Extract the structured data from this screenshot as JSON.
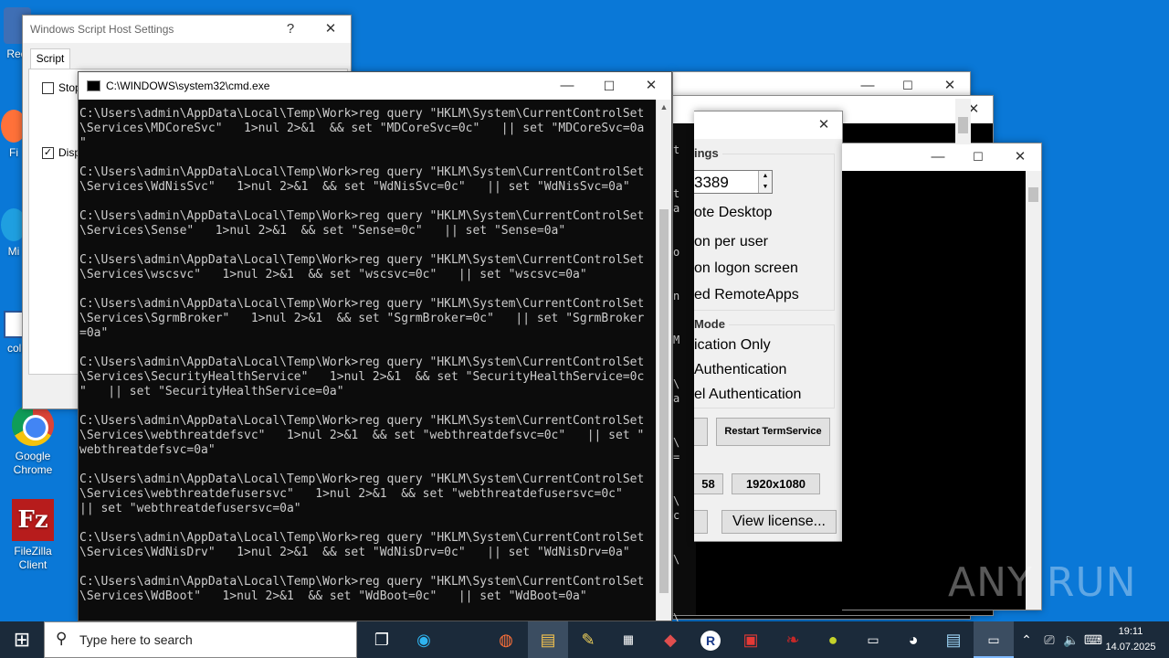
{
  "desktop": {
    "icons": [
      {
        "label": "Rec",
        "icon": "recycle-bin-icon"
      },
      {
        "label": "Fi",
        "icon": "firefox-icon"
      },
      {
        "label": "Mi",
        "icon": "edge-icon"
      },
      {
        "label": "coll",
        "icon": "word-icon"
      },
      {
        "label": "Google Chrome",
        "icon": "chrome-icon"
      },
      {
        "label": "FileZilla Client",
        "icon": "filezilla-icon"
      }
    ]
  },
  "wsh_window": {
    "title": "Windows Script Host Settings",
    "help_glyph": "?",
    "close_glyph": "✕",
    "tab": "Script",
    "checkbox1_label": "Stop",
    "checkbox1_checked": false,
    "checkbox2_label": "Disp",
    "checkbox2_checked": true
  },
  "cmd_window": {
    "title": "C:\\WINDOWS\\system32\\cmd.exe",
    "minimize_glyph": "—",
    "maximize_glyph": "☐",
    "close_glyph": "✕",
    "lines": [
      "C:\\Users\\admin\\AppData\\Local\\Temp\\Work>reg query \"HKLM\\System\\CurrentControlSet",
      "\\Services\\MDCoreSvc\"   1>nul 2>&1  && set \"MDCoreSvc=0c\"   || set \"MDCoreSvc=0a",
      "\"",
      "",
      "C:\\Users\\admin\\AppData\\Local\\Temp\\Work>reg query \"HKLM\\System\\CurrentControlSet",
      "\\Services\\WdNisSvc\"   1>nul 2>&1  && set \"WdNisSvc=0c\"   || set \"WdNisSvc=0a\"",
      "",
      "C:\\Users\\admin\\AppData\\Local\\Temp\\Work>reg query \"HKLM\\System\\CurrentControlSet",
      "\\Services\\Sense\"   1>nul 2>&1  && set \"Sense=0c\"   || set \"Sense=0a\"",
      "",
      "C:\\Users\\admin\\AppData\\Local\\Temp\\Work>reg query \"HKLM\\System\\CurrentControlSet",
      "\\Services\\wscsvc\"   1>nul 2>&1  && set \"wscsvc=0c\"   || set \"wscsvc=0a\"",
      "",
      "C:\\Users\\admin\\AppData\\Local\\Temp\\Work>reg query \"HKLM\\System\\CurrentControlSet",
      "\\Services\\SgrmBroker\"   1>nul 2>&1  && set \"SgrmBroker=0c\"   || set \"SgrmBroker",
      "=0a\"",
      "",
      "C:\\Users\\admin\\AppData\\Local\\Temp\\Work>reg query \"HKLM\\System\\CurrentControlSet",
      "\\Services\\SecurityHealthService\"   1>nul 2>&1  && set \"SecurityHealthService=0c",
      "\"   || set \"SecurityHealthService=0a\"",
      "",
      "C:\\Users\\admin\\AppData\\Local\\Temp\\Work>reg query \"HKLM\\System\\CurrentControlSet",
      "\\Services\\webthreatdefsvc\"   1>nul 2>&1  && set \"webthreatdefsvc=0c\"   || set \"",
      "webthreatdefsvc=0a\"",
      "",
      "C:\\Users\\admin\\AppData\\Local\\Temp\\Work>reg query \"HKLM\\System\\CurrentControlSet",
      "\\Services\\webthreatdefusersvc\"   1>nul 2>&1  && set \"webthreatdefusersvc=0c\"",
      "|| set \"webthreatdefusersvc=0a\"",
      "",
      "C:\\Users\\admin\\AppData\\Local\\Temp\\Work>reg query \"HKLM\\System\\CurrentControlSet",
      "\\Services\\WdNisDrv\"   1>nul 2>&1  && set \"WdNisDrv=0c\"   || set \"WdNisDrv=0a\"",
      "",
      "C:\\Users\\admin\\AppData\\Local\\Temp\\Work>reg query \"HKLM\\System\\CurrentControlSet",
      "\\Services\\WdBoot\"   1>nul 2>&1  && set \"WdBoot=0c\"   || set \"WdBoot=0a\""
    ]
  },
  "bg_console": {
    "minimize_glyph": "—",
    "maximize_glyph": "☐",
    "close_glyph": "✕",
    "edge_chars": [
      "t",
      "t",
      "a",
      "o",
      "n",
      "M",
      "\\",
      "a",
      "\\",
      "=",
      "\\",
      "c",
      "\\",
      "\\"
    ]
  },
  "rdp_window": {
    "close_glyph": "✕",
    "section1_label": "ings",
    "port_value": "3389",
    "options": [
      "ote Desktop",
      "on per user",
      "on logon screen",
      "ed RemoteApps"
    ],
    "section2_label": "Mode",
    "auth_options": [
      "ication Only",
      "Authentication",
      "el Authentication"
    ],
    "restart_button": "Restart TermService",
    "res_left": "58",
    "res_button": "1920x1080",
    "license_button": "View license..."
  },
  "watermark": "ANY RUN",
  "taskbar": {
    "search_placeholder": "Type here to search",
    "time": "19:11",
    "date": "14.07.2025",
    "app_icons": [
      "task-view-icon",
      "edge-icon",
      "firefox-icon",
      "file-explorer-icon",
      "tool-icon",
      "calculator-icon",
      "redapp-icon",
      "r-app-icon",
      "package-icon",
      "mouse-icon",
      "kiwi-icon",
      "terminal-icon",
      "ghost-icon",
      "notepad-icon",
      "cmd-icon"
    ]
  }
}
